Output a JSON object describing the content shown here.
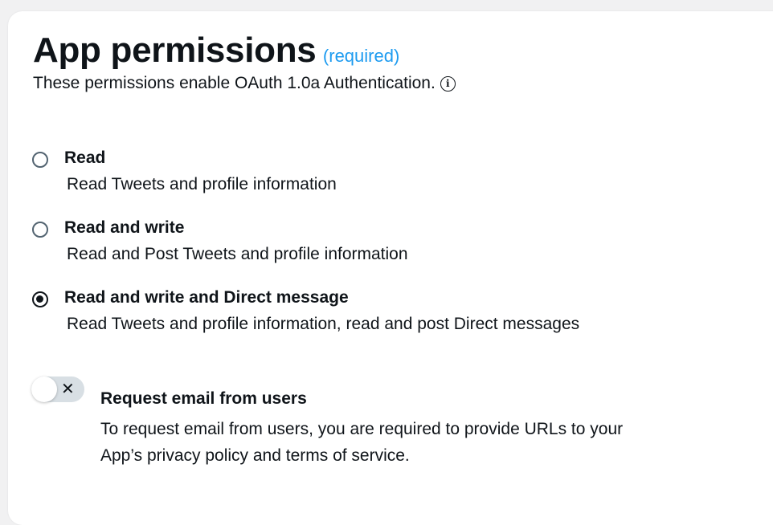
{
  "header": {
    "title": "App permissions",
    "required_label": "(required)",
    "subtitle": "These permissions enable OAuth 1.0a Authentication.",
    "info_icon_glyph": "i"
  },
  "permissions": {
    "options": [
      {
        "label": "Read",
        "description": "Read Tweets and profile information",
        "selected": false
      },
      {
        "label": "Read and write",
        "description": "Read and Post Tweets and profile information",
        "selected": false
      },
      {
        "label": "Read and write and Direct message",
        "description": "Read Tweets and profile information, read and post Direct messages",
        "selected": true
      }
    ]
  },
  "email_request": {
    "label": "Request email from users",
    "description_line1": "To request email from users, you are required to provide URLs to your",
    "description_line2": "App’s privacy policy and terms of service.",
    "enabled": false,
    "toggle_glyph": "✕"
  },
  "colors": {
    "accent": "#1d9bf0",
    "text": "#0f1419",
    "toggle_track_off": "#d8dfe4"
  }
}
